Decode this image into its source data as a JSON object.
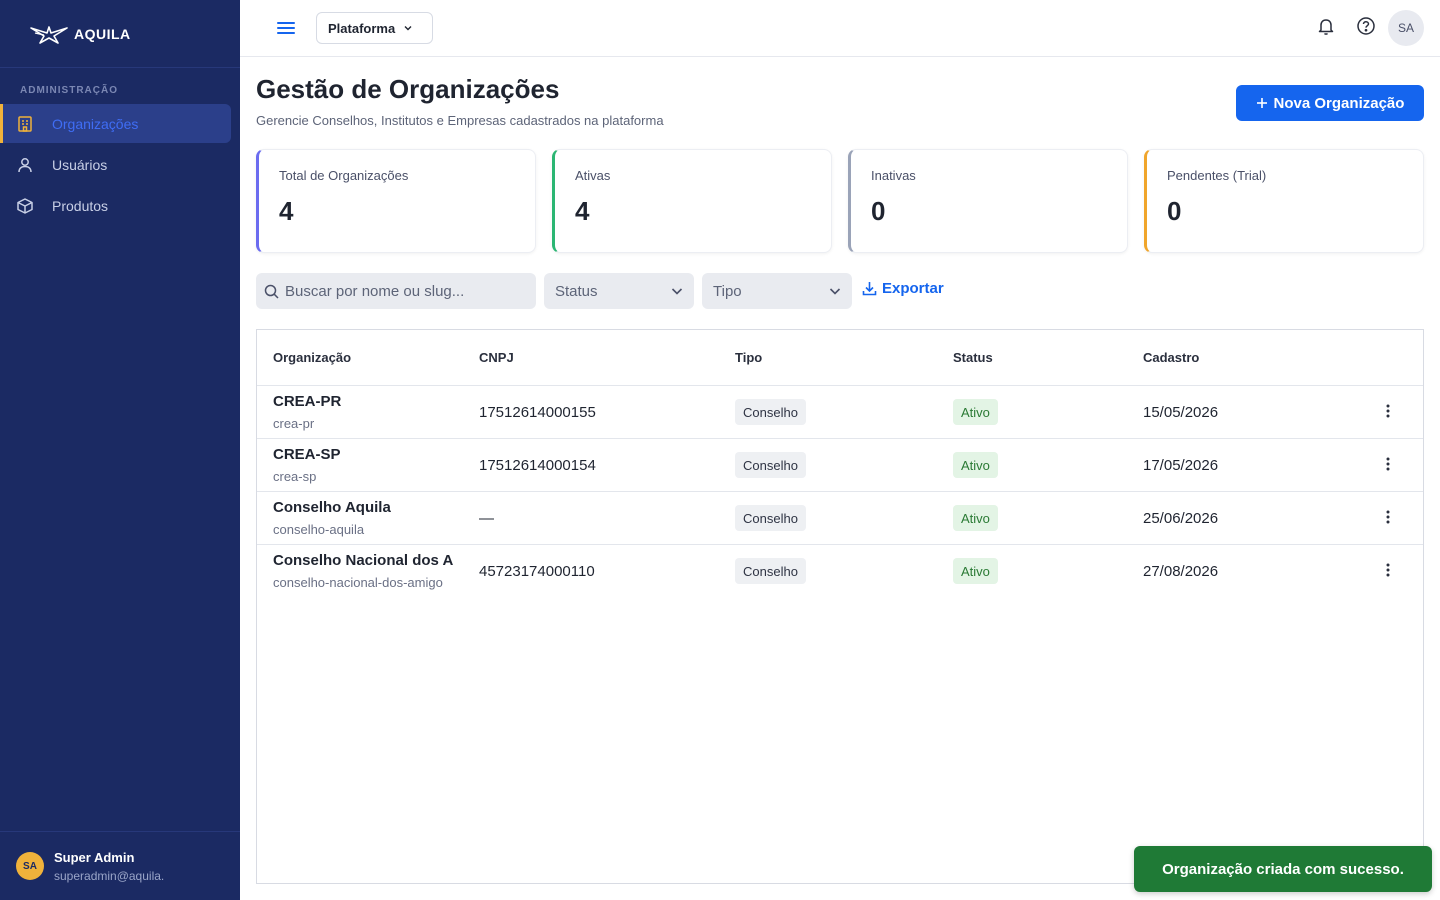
{
  "app": {
    "brand": "AQUILA"
  },
  "sidebar": {
    "section_label": "ADMINISTRAÇÃO",
    "items": [
      {
        "label": "Organizações",
        "icon": "building-icon",
        "active": true
      },
      {
        "label": "Usuários",
        "icon": "user-icon",
        "active": false
      },
      {
        "label": "Produtos",
        "icon": "box-icon",
        "active": false
      }
    ],
    "user": {
      "initials": "SA",
      "name": "Super Admin",
      "email": "superadmin@aquila."
    }
  },
  "topbar": {
    "platform_label": "Plataforma",
    "avatar_initials": "SA"
  },
  "page": {
    "title": "Gestão de Organizações",
    "subtitle": "Gerencie Conselhos, Institutos e Empresas cadastrados na plataforma",
    "new_button": "Nova Organização"
  },
  "stats": [
    {
      "label": "Total de Organizações",
      "value": "4",
      "accent": "#6b6cf0"
    },
    {
      "label": "Ativas",
      "value": "4",
      "accent": "#2bb673"
    },
    {
      "label": "Inativas",
      "value": "0",
      "accent": "#9aa3b8"
    },
    {
      "label": "Pendentes (Trial)",
      "value": "0",
      "accent": "#f0a52b"
    }
  ],
  "filters": {
    "search_placeholder": "Buscar por nome ou slug...",
    "status_label": "Status",
    "type_label": "Tipo",
    "export_label": "Exportar"
  },
  "table": {
    "columns": [
      "Organização",
      "CNPJ",
      "Tipo",
      "Status",
      "Cadastro"
    ],
    "rows": [
      {
        "name": "CREA-PR",
        "slug": "crea-pr",
        "cnpj": "17512614000155",
        "type": "Conselho",
        "status": "Ativo",
        "date": "15/05/2026"
      },
      {
        "name": "CREA-SP",
        "slug": "crea-sp",
        "cnpj": "17512614000154",
        "type": "Conselho",
        "status": "Ativo",
        "date": "17/05/2026"
      },
      {
        "name": "Conselho Aquila",
        "slug": "conselho-aquila",
        "cnpj": "—",
        "type": "Conselho",
        "status": "Ativo",
        "date": "25/06/2026"
      },
      {
        "name": "Conselho Nacional dos A",
        "slug": "conselho-nacional-dos-amigo",
        "cnpj": "45723174000110",
        "type": "Conselho",
        "status": "Ativo",
        "date": "27/08/2026"
      }
    ]
  },
  "toast": {
    "message": "Organização criada com sucesso."
  },
  "colors": {
    "sidebar_bg": "#1b2a63",
    "primary": "#1565ee",
    "success": "#1f7a36",
    "active_accent": "#f0b23b"
  }
}
